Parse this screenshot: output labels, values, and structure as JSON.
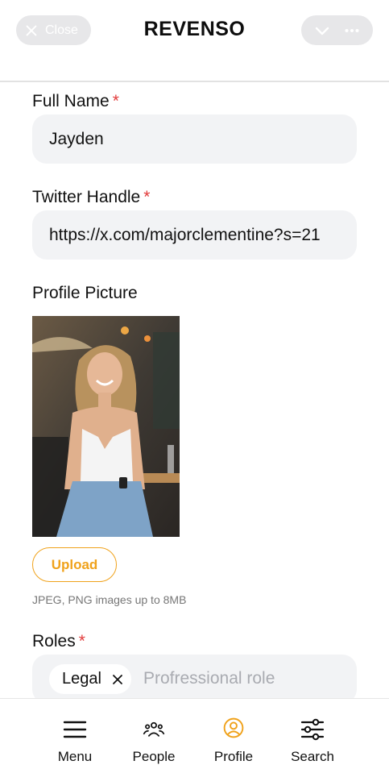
{
  "header": {
    "close_label": "Close",
    "title": "REVENSO"
  },
  "form": {
    "full_name": {
      "label": "Full Name",
      "required": "*",
      "value": "Jayden"
    },
    "twitter": {
      "label": "Twitter Handle",
      "required": "*",
      "value": "https://x.com/majorclementine?s=21"
    },
    "profile_picture": {
      "label": "Profile Picture",
      "upload_label": "Upload",
      "hint": "JPEG, PNG images up to 8MB"
    },
    "roles": {
      "label": "Roles",
      "required": "*",
      "chips": [
        "Legal"
      ],
      "placeholder": "Profressional role"
    }
  },
  "bottom_nav": {
    "items": [
      {
        "label": "Menu",
        "icon": "menu-icon"
      },
      {
        "label": "People",
        "icon": "people-icon"
      },
      {
        "label": "Profile",
        "icon": "profile-icon"
      },
      {
        "label": "Search",
        "icon": "sliders-icon"
      }
    ],
    "active": "Profile"
  },
  "colors": {
    "accent": "#f0a21b",
    "required": "#e23b3b",
    "field_bg": "#f2f3f5",
    "pill_bg": "#e7e7e9"
  }
}
